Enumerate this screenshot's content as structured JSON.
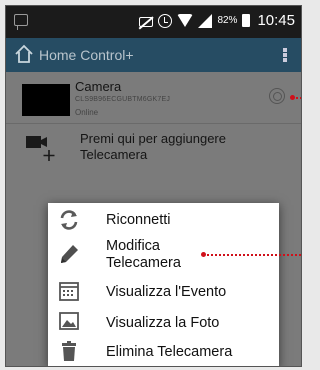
{
  "status_bar": {
    "battery": "82%",
    "time": "10:45"
  },
  "app_bar": {
    "title": "Home Control+"
  },
  "camera": {
    "name": "Camera",
    "uid": "CLS9B96ECGUBTM6GK7EJ",
    "status": "Online"
  },
  "add_camera": {
    "line1": "Premi qui per aggiungere",
    "line2": "Telecamera"
  },
  "menu": {
    "items": [
      {
        "label": "Riconnetti",
        "icon": "refresh-icon"
      },
      {
        "label_line1": "Modifica",
        "label_line2": "Telecamera",
        "icon": "pencil-icon"
      },
      {
        "label": "Visualizza l'Evento",
        "icon": "calendar-icon"
      },
      {
        "label": "Visualizza la Foto",
        "icon": "photo-icon"
      },
      {
        "label": "Elimina Telecamera",
        "icon": "trash-icon"
      }
    ]
  },
  "colors": {
    "app_bar": "#264c63",
    "callout": "#d0101a",
    "dim_overlay": "#7b7b7b"
  }
}
